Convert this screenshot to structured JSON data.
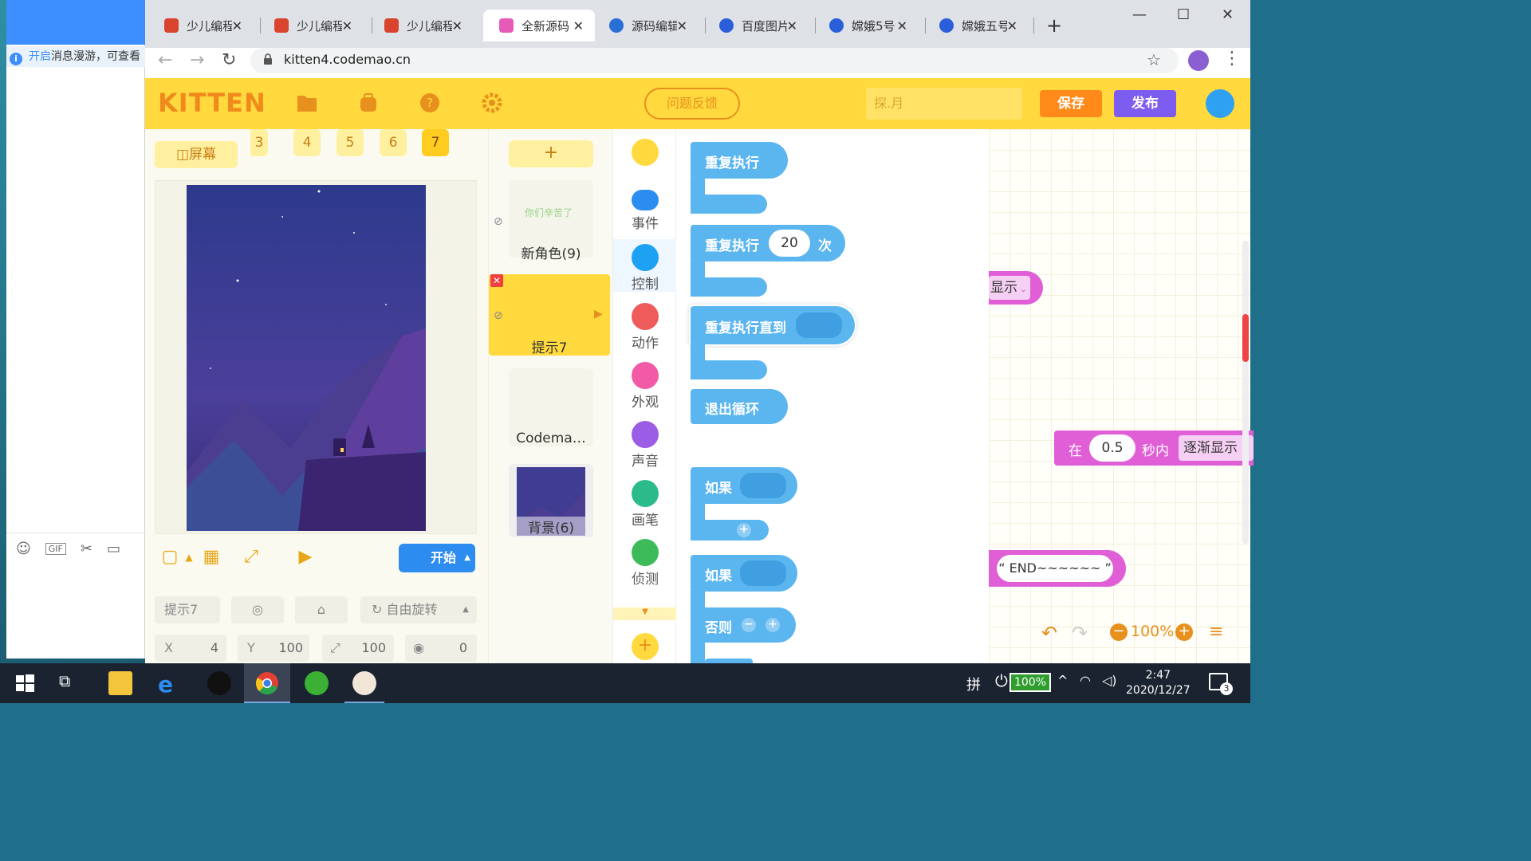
{
  "chat": {
    "notice_highlight": "开启",
    "notice_text": "消息漫游，可查看"
  },
  "tabs": [
    {
      "label": "少儿编程",
      "icon_color": "#d9442f"
    },
    {
      "label": "少儿编程",
      "icon_color": "#d9442f"
    },
    {
      "label": "少儿编程",
      "icon_color": "#d9442f"
    },
    {
      "label": "全新源码",
      "icon_color": "#e85ab8"
    },
    {
      "label": "源码编辑",
      "icon_color": "#2a6fd6"
    },
    {
      "label": "百度图片",
      "icon_color": "#2b5fd9"
    },
    {
      "label": "嫦娥5号",
      "icon_color": "#2b5fd9"
    },
    {
      "label": "嫦娥五号",
      "icon_color": "#2b5fd9"
    }
  ],
  "browser": {
    "url": "kitten4.codemao.cn"
  },
  "app": {
    "logo": "KITTEN",
    "feedback": "问题反馈",
    "search_placeholder": "探.月",
    "save": "保存",
    "publish": "发布"
  },
  "stage": {
    "screen_btn": "屏幕",
    "scenes": [
      "3",
      "4",
      "5",
      "6",
      "7"
    ],
    "active_scene": "7",
    "start": "开始",
    "sprite_name": "提示7",
    "rotation": "自由旋转",
    "x_label": "X",
    "x": "4",
    "y_label": "Y",
    "y": "100",
    "size": "100",
    "direction": "0"
  },
  "sprites": {
    "add": "+",
    "items": [
      {
        "name": "新角色(9)",
        "thumb_text": "你们辛苦了"
      },
      {
        "name": "提示7"
      },
      {
        "name": "Codema…"
      },
      {
        "name": "背景(6)"
      }
    ]
  },
  "categories": [
    {
      "label": "事件",
      "color": "#2c8cf0"
    },
    {
      "label": "控制",
      "color": "#1da1f2"
    },
    {
      "label": "动作",
      "color": "#ef5a5a"
    },
    {
      "label": "外观",
      "color": "#f25aa5"
    },
    {
      "label": "声音",
      "color": "#9b5de5"
    },
    {
      "label": "画笔",
      "color": "#2bbb8a"
    },
    {
      "label": "侦测",
      "color": "#3dbb5b"
    }
  ],
  "blocks": {
    "repeat_forever": "重复执行",
    "repeat_n_a": "重复执行",
    "repeat_n_value": "20",
    "repeat_n_b": "次",
    "repeat_until": "重复执行直到",
    "break": "退出循环",
    "if1": "如果",
    "if2": "如果",
    "else": "否则"
  },
  "workspace": {
    "show": "显示",
    "fade_a": "在",
    "fade_value": "0.5",
    "fade_b": "秒内",
    "fade_mode": "逐渐显示",
    "end_text": "“ END~~~~~~ ”",
    "zoom": "100%"
  },
  "taskbar": {
    "battery": "100%",
    "time": "2:47",
    "date": "2020/12/27",
    "ime": "拼",
    "notif_count": "3"
  }
}
